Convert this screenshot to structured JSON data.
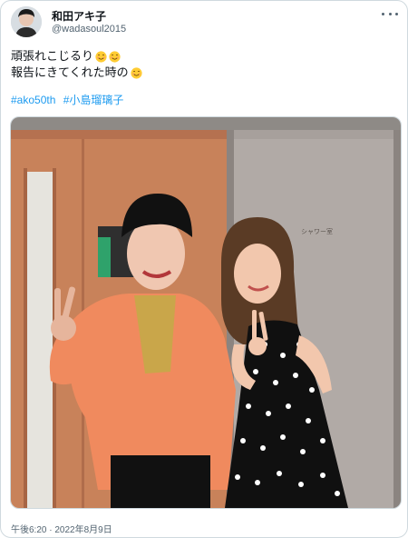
{
  "tweet": {
    "display_name": "和田アキ子",
    "handle": "@wadasoul2015",
    "text_line1": "頑張れこじるり",
    "text_line2": "報告にきてくれた時の",
    "emoji_line1": [
      "smiling-face-icon",
      "smiling-face-icon"
    ],
    "emoji_line2": [
      "smiling-face-icon"
    ],
    "hashtags": [
      "#ako50th",
      "#小島瑠璃子"
    ],
    "photo_sign_text": "シャワー室",
    "timestamp": "午後6:20 · 2022年8月9日"
  },
  "colors": {
    "link": "#1d9bf0",
    "secondary_text": "#536471",
    "border": "#cfd9de",
    "door_wood": "#c8825a",
    "door_grey": "#a7a09c",
    "cardigan": "#f08a5e",
    "blouse": "#c9a64a"
  }
}
